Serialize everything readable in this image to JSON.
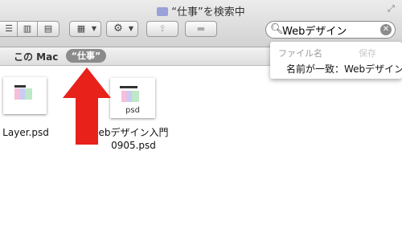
{
  "window": {
    "title": "“仕事”を検索中"
  },
  "search": {
    "query": "Webデザイン",
    "clear_icon": "clear-icon"
  },
  "scope": {
    "location": "この Mac",
    "tag": "“仕事”"
  },
  "popup": {
    "category": "ファイル名",
    "save_label": "保存",
    "suggestion": "名前が一致：Webデザイン"
  },
  "files": [
    {
      "name": "Layer.psd",
      "ext": ""
    },
    {
      "name_line1": "ebデザイン入門",
      "name_line2": "0905.psd",
      "ext": "psd"
    }
  ],
  "annotation": {
    "arrow_color": "#e8211b"
  }
}
